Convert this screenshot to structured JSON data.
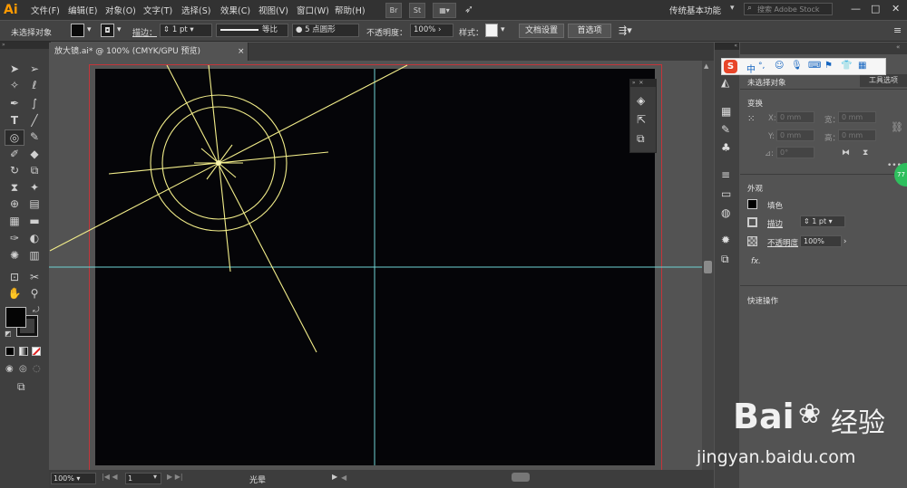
{
  "app": {
    "logo": "Ai"
  },
  "menubar": {
    "items": [
      "文件(F)",
      "编辑(E)",
      "对象(O)",
      "文字(T)",
      "选择(S)",
      "效果(C)",
      "视图(V)",
      "窗口(W)",
      "帮助(H)"
    ],
    "bridge": "Br",
    "stock": "St",
    "workspace": "传统基本功能",
    "search_placeholder": "搜索 Adobe Stock",
    "win_min": "—",
    "win_max": "□",
    "win_close": "✕"
  },
  "controlbar": {
    "selection": "未选择对象",
    "stroke_label": "描边：",
    "stroke_value": "1 pt",
    "profile_label": "等比",
    "brush_label": "5 点圆形",
    "opacity_label": "不透明度：",
    "opacity_value": "100%",
    "style_label": "样式：",
    "doc_setup": "文档设置",
    "preferences": "首选项"
  },
  "document": {
    "tab_title": "放大镜.ai* @ 100% (CMYK/GPU 预览)",
    "tab_close": "×"
  },
  "statusbar": {
    "zoom": "100%",
    "artboard_num": "1",
    "status_text": "光晕"
  },
  "ime": {
    "chars": [
      "中",
      "°,"
    ]
  },
  "properties": {
    "tab_label": "工具选项",
    "no_selection": "未选择对象",
    "transform_title": "变换",
    "x_label": "X:",
    "y_label": "Y:",
    "w_label": "宽：",
    "h_label": "高：",
    "x_value": "0 mm",
    "y_value": "0 mm",
    "w_value": "0 mm",
    "h_value": "0 mm",
    "angle_label": "⊿:",
    "angle_value": "0°",
    "appearance_title": "外观",
    "fill_label": "填色",
    "stroke_label": "描边",
    "stroke_value": "1 pt",
    "opacity_label": "不透明度",
    "opacity_value": "100%",
    "fx_label": "fx.",
    "quick_actions": "快速操作",
    "more": "•••"
  },
  "watermark": {
    "text": "Bai",
    "text2": "经验",
    "url": "jingyan.baidu.com"
  },
  "colors": {
    "accent_artboard_border": "#c4353a",
    "guide": "#6fd3d3",
    "flare": "#f3ee8a"
  }
}
